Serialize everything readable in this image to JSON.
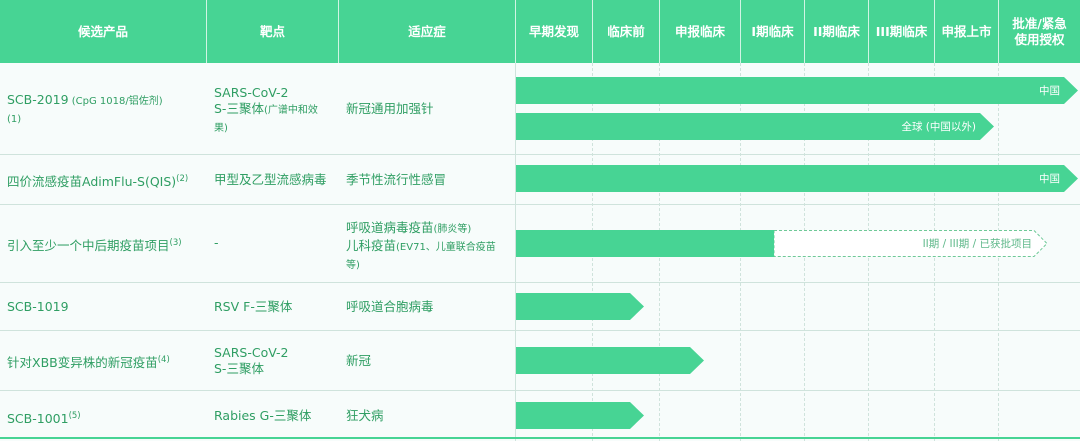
{
  "header": {
    "candidate": "候选产品",
    "target": "靶点",
    "indication": "适应症",
    "stages": [
      "早期发现",
      "临床前",
      "申报临床",
      "I期临床",
      "II期临床",
      "III期临床",
      "申报上市",
      "批准/紧急\n使用授权"
    ]
  },
  "rows": [
    {
      "candidate": "SCB-2019",
      "candidate_suffix": " (CpG 1018/铝佐剂)",
      "note": "(1)",
      "target_line1": "SARS-CoV-2",
      "target_line2": "S-三聚体",
      "target_suffix": "(广谱中和效",
      "target_line3": "果)",
      "indication": "新冠通用加强针",
      "bar1_label": "中国",
      "bar2_label": "全球 (中国以外)",
      "bar1_progress": 1.0,
      "bar2_progress": 0.885
    },
    {
      "candidate": "四价流感疫苗AdimFlu-S(QIS)",
      "note": "(2)",
      "target": "甲型及乙型流感病毒",
      "indication": "季节性流行性感冒",
      "bar_label": "中国",
      "bar_progress": 1.0
    },
    {
      "candidate": "引入至少一个中后期疫苗项目",
      "note": "(3)",
      "target": "-",
      "ind_line1": "呼吸道病毒疫苗",
      "ind_line1_suffix": "(肺炎等)",
      "ind_line2": "儿科疫苗",
      "ind_line2_suffix": "(EV71、儿童联合疫苗",
      "ind_line3": "等)",
      "bar_label": "II期 / III期 / 已获批项目",
      "bar_progress": 0.465
    },
    {
      "candidate": "SCB-1019",
      "target": "RSV F-三聚体",
      "indication": "呼吸道合胞病毒",
      "bar_progress": 0.228
    },
    {
      "candidate": "针对XBB变异株的新冠疫苗",
      "note": "(4)",
      "target_line1": "SARS-CoV-2",
      "target_line2": "S-三聚体",
      "indication": "新冠",
      "bar_progress": 0.335
    },
    {
      "candidate": "SCB-1001",
      "note": "(5)",
      "target": "Rabies G-三聚体",
      "indication": "狂犬病",
      "bar_progress": 0.228
    }
  ],
  "colors": {
    "accent": "#47d494",
    "text": "#2f9e63",
    "background": "#f7fcfb"
  }
}
